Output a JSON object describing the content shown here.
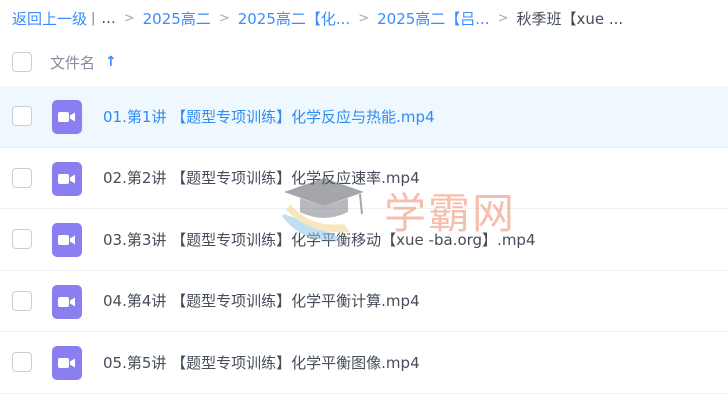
{
  "breadcrumb": {
    "back": "返回上一级",
    "ellipsis": "...",
    "items": [
      "2025高二",
      "2025高二【化...",
      "2025高二【吕..."
    ],
    "current": "秋季班【xue ..."
  },
  "list_header": {
    "column_name": "文件名",
    "sort_icon": "arrow-up-icon"
  },
  "files": [
    {
      "name": "01.第1讲 【题型专项训练】化学反应与热能.mp4",
      "icon": "video-file-icon",
      "selected": true
    },
    {
      "name": "02.第2讲 【题型专项训练】化学反应速率.mp4",
      "icon": "video-file-icon",
      "selected": false
    },
    {
      "name": "03.第3讲 【题型专项训练】化学平衡移动【xue -ba.org】.mp4",
      "icon": "video-file-icon",
      "selected": false
    },
    {
      "name": "04.第4讲 【题型专项训练】化学平衡计算.mp4",
      "icon": "video-file-icon",
      "selected": false
    },
    {
      "name": "05.第5讲 【题型专项训练】化学平衡图像.mp4",
      "icon": "video-file-icon",
      "selected": false
    }
  ],
  "watermark": {
    "text": "学霸网"
  },
  "colors": {
    "accent": "#3b8cff",
    "file_icon": "#8a7ff0",
    "selected_row": "#f0f8ff"
  }
}
